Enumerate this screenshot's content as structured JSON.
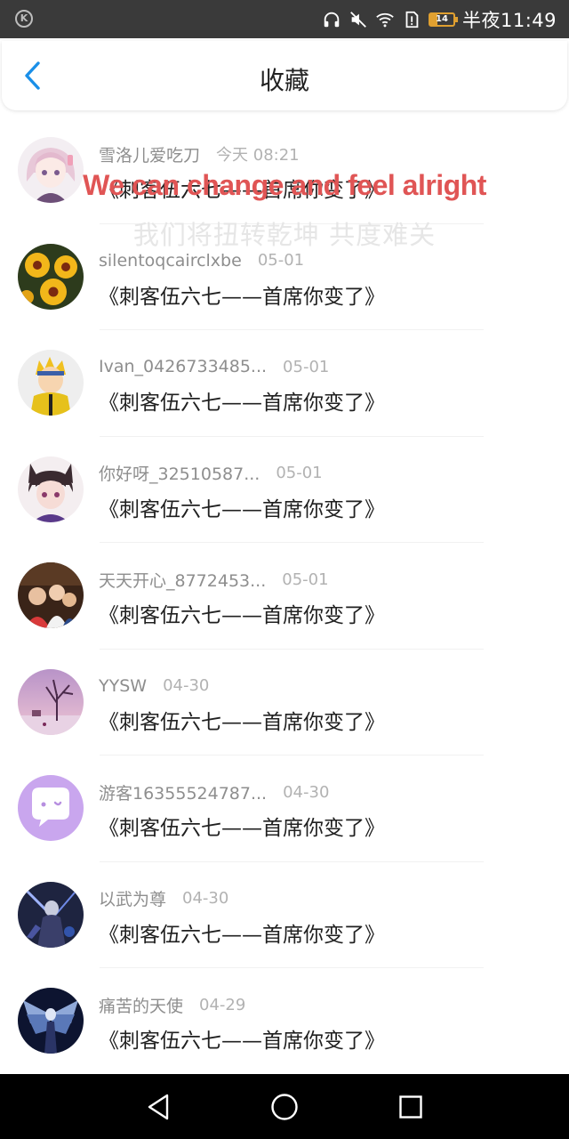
{
  "status_bar": {
    "time": "半夜11:49",
    "battery": "14",
    "left_icon": "k-icon",
    "icons": [
      "headphones-icon",
      "mute-icon",
      "wifi-icon",
      "alert-icon",
      "battery-icon"
    ]
  },
  "header": {
    "title": "收藏",
    "back_icon": "chevron-left-icon"
  },
  "overlay": {
    "english": "We can change and feel alright",
    "chinese": "我们将扭转乾坤 共度难关"
  },
  "items": [
    {
      "user": "雪洛儿爱吃刀",
      "date": "今天 08:21",
      "message": "《刺客伍六七——首席你变了》",
      "avatar": "anime-girl-avatar"
    },
    {
      "user": "silentoqcairclxbe",
      "date": "05-01",
      "message": "《刺客伍六七——首席你变了》",
      "avatar": "yellow-flowers-avatar"
    },
    {
      "user": "Ivan_0426733485...",
      "date": "05-01",
      "message": "《刺客伍六七——首席你变了》",
      "avatar": "naruto-avatar"
    },
    {
      "user": "你好呀_32510587...",
      "date": "05-01",
      "message": "《刺客伍六七——首席你变了》",
      "avatar": "cat-ear-boy-avatar"
    },
    {
      "user": "天天开心_8772453...",
      "date": "05-01",
      "message": "《刺客伍六七——首席你变了》",
      "avatar": "family-photo-avatar"
    },
    {
      "user": "YYSW",
      "date": "04-30",
      "message": "《刺客伍六七——首席你变了》",
      "avatar": "purple-tree-avatar"
    },
    {
      "user": "游客16355524787...",
      "date": "04-30",
      "message": "《刺客伍六七——首席你变了》",
      "avatar": "chat-bubble-avatar"
    },
    {
      "user": "以武为尊",
      "date": "04-30",
      "message": "《刺客伍六七——首席你变了》",
      "avatar": "dark-warrior-avatar"
    },
    {
      "user": "痛苦的天使",
      "date": "04-29",
      "message": "《刺客伍六七——首席你变了》",
      "avatar": "dark-angel-avatar"
    }
  ],
  "nav_bar": {
    "back": "triangle-back-icon",
    "home": "circle-home-icon",
    "recents": "square-recents-icon"
  },
  "colors": {
    "accent": "#1a8fe8",
    "overlay_en": "#e05555",
    "status_bar_bg": "#3a3a3a",
    "nav_bar_bg": "#000000"
  }
}
